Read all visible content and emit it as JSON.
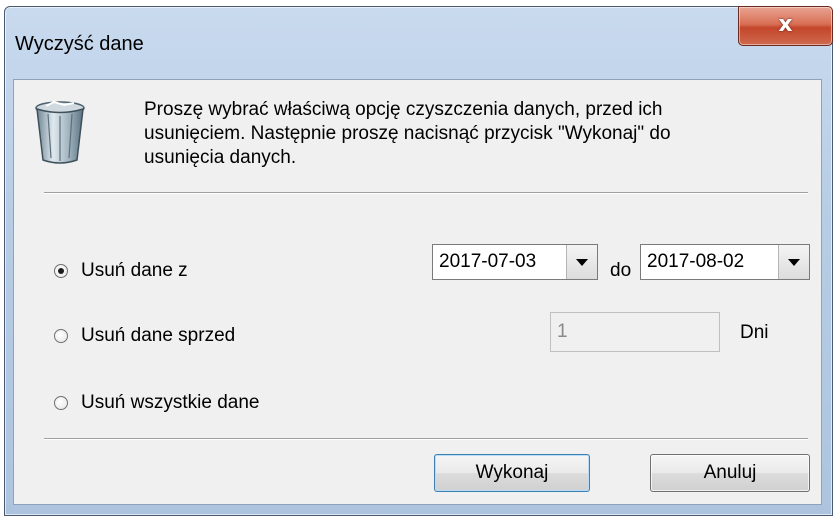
{
  "window": {
    "title": "Wyczyść dane",
    "close_glyph": "x"
  },
  "intro": {
    "icon": "recycle-bin-icon",
    "text": "Proszę wybrać właściwą opcję czyszczenia danych, przed ich\nusunięciem. Następnie proszę nacisnąć przycisk \"Wykonaj\" do\nusunięcia danych."
  },
  "options": {
    "range": {
      "label": "Usuń dane z",
      "selected": true
    },
    "before": {
      "label": "Usuń dane sprzed",
      "selected": false
    },
    "all": {
      "label": "Usuń wszystkie dane",
      "selected": false
    }
  },
  "range": {
    "from_value": "2017-07-03",
    "to_label": "do",
    "to_value": "2017-08-02"
  },
  "before": {
    "days_value": "1",
    "days_unit": "Dni"
  },
  "buttons": {
    "execute": "Wykonaj",
    "cancel": "Anuluj"
  }
}
